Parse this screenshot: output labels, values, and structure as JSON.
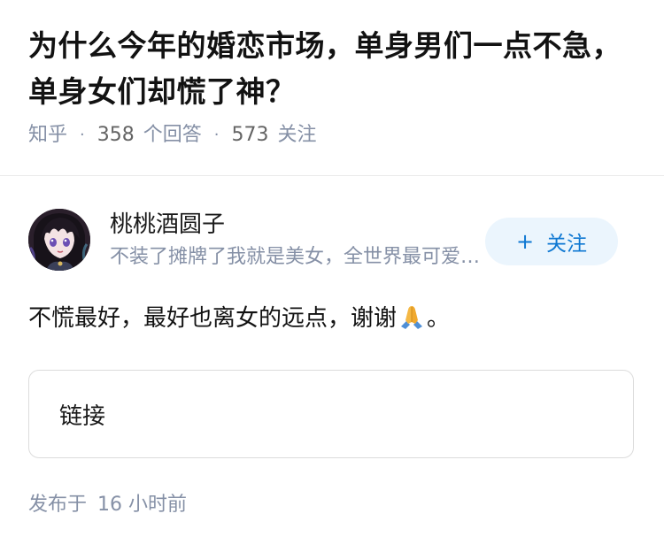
{
  "question": {
    "title": "为什么今年的婚恋市场，单身男们一点不急，单身女们却慌了神？",
    "source": "知乎",
    "answers_count": "358",
    "answers_label": "个回答",
    "followers_count": "573",
    "followers_label": "关注"
  },
  "author": {
    "name": "桃桃酒圆子",
    "bio": "不装了摊牌了我就是美女，全世界最可爱的美女",
    "avatar_icon": "anime-avatar-icon",
    "follow_label": "关注"
  },
  "answer": {
    "text": "不慌最好，最好也离女的远点，谢谢",
    "emoji": "folded-hands-icon",
    "text_end": "。"
  },
  "link_card": {
    "label": "链接"
  },
  "meta": {
    "published_prefix": "发布于",
    "published_value": "16 小时前"
  },
  "colors": {
    "accent": "#0f78d2",
    "button_bg": "#ebf5fd",
    "muted_text": "#8590a6"
  }
}
